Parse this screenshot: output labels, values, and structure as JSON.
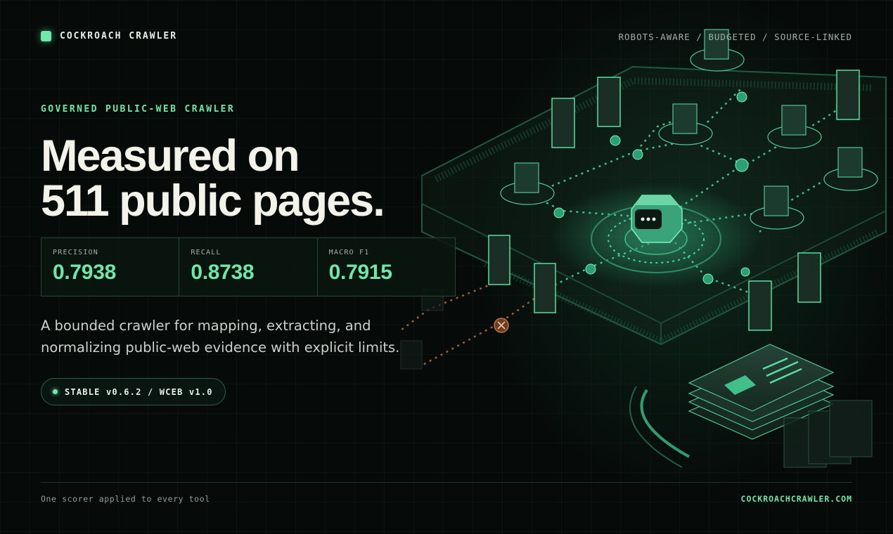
{
  "brand": {
    "name": "COCKROACH CRAWLER"
  },
  "header": {
    "tags": "ROBOTS-AWARE / BUDGETED / SOURCE-LINKED"
  },
  "hero": {
    "eyebrow": "GOVERNED PUBLIC-WEB CRAWLER",
    "headline_line1": "Measured on",
    "headline_line2": "511 public pages."
  },
  "metrics": [
    {
      "label": "PRECISION",
      "value": "0.7938"
    },
    {
      "label": "RECALL",
      "value": "0.8738"
    },
    {
      "label": "MACRO F1",
      "value": "0.7915"
    }
  ],
  "description": "A bounded crawler for mapping, extracting, and normalizing public-web evidence with explicit limits.",
  "version_pill": "STABLE v0.6.2 / WCEB v1.0",
  "footer": {
    "left": "One scorer applied to every tool",
    "right": "COCKROACHCRAWLER.COM"
  },
  "colors": {
    "accent": "#6ee8a8",
    "background": "#060b09",
    "warning": "#c4743f"
  },
  "illustration": {
    "icons": [
      "crawler-bot-icon",
      "server-node-icon",
      "web-page-node-icon",
      "checkmark-icon",
      "blocked-x-icon",
      "document-stack-icon"
    ]
  }
}
